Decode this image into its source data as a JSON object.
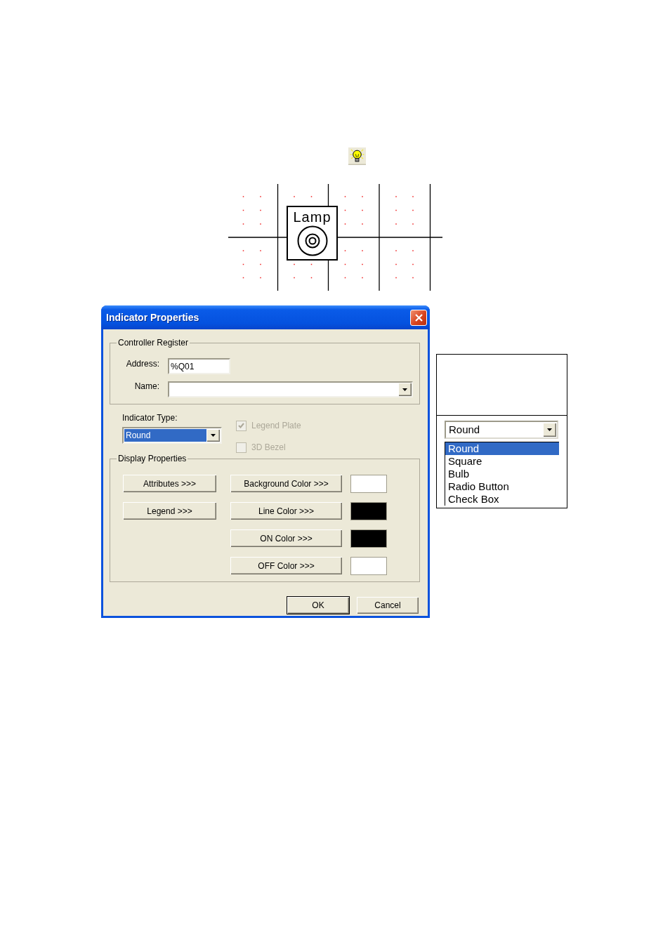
{
  "diagram": {
    "element": {
      "label": "Lamp"
    }
  },
  "dialog": {
    "title": "Indicator Properties",
    "controller_register": {
      "legend": "Controller Register",
      "address": {
        "label": "Address:",
        "value": "%Q01"
      },
      "name": {
        "label": "Name:"
      }
    },
    "indicator_type": {
      "label": "Indicator Type:",
      "value": "Round",
      "focused": true
    },
    "checkboxes": [
      {
        "label": "Legend Plate",
        "checked": true,
        "disabled": true
      },
      {
        "label": "3D Bezel",
        "checked": false,
        "disabled": true
      }
    ],
    "display_properties": {
      "legend": "Display Properties",
      "buttons": [
        {
          "label": "Attributes >>>"
        },
        {
          "label": "Legend >>>"
        }
      ],
      "color_buttons": [
        {
          "label": "Background Color >>>",
          "color": "#ffffff"
        },
        {
          "label": "Line Color >>>",
          "color": "#000000"
        },
        {
          "label": "ON Color >>>",
          "color": "#000000"
        },
        {
          "label": "OFF Color >>>",
          "color": "#ffffff"
        }
      ]
    },
    "buttons": [
      {
        "label": "OK",
        "default": true
      },
      {
        "label": "Cancel",
        "default": false
      }
    ]
  },
  "dropdown_preview": {
    "value": "Round",
    "options": [
      {
        "label": "Round",
        "selected": true
      },
      {
        "label": "Square",
        "selected": false
      },
      {
        "label": "Bulb",
        "selected": false
      },
      {
        "label": "Radio Button",
        "selected": false
      },
      {
        "label": "Check Box",
        "selected": false
      }
    ]
  }
}
